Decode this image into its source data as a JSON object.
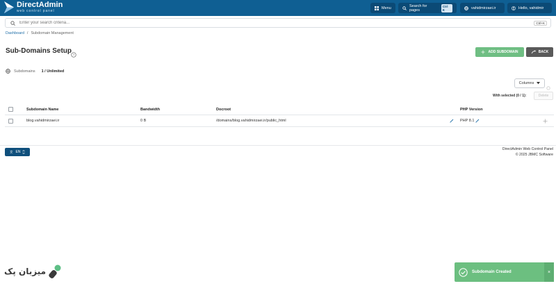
{
  "header": {
    "logo_title": "DirectAdmin",
    "logo_subtitle": "web control panel",
    "menu_label": "Menu",
    "search_pages_label": "Search for pages",
    "search_pages_kbd": "Ctrl K",
    "account_label": "vahidmirzaei.ir",
    "user_label": "Hello, vahidmir"
  },
  "search": {
    "placeholder": "Enter your search criteria...",
    "shortcut": "Ctrl+K"
  },
  "breadcrumb": {
    "home": "Dashboard",
    "separator": "/",
    "current": "Subdomain Management"
  },
  "page": {
    "title": "Sub-Domains Setup",
    "add_button": "ADD SUBDOMAIN",
    "back_button": "BACK",
    "summary_label": "Subdomains",
    "summary_count": "1 / Unlimited",
    "columns_button": "Columns",
    "with_selected": "With selected (0 / 1):",
    "delete_button": "Delete"
  },
  "table": {
    "headers": {
      "name": "Subdomain Name",
      "bandwidth": "Bandwidth",
      "docroot": "Docroot",
      "php": "PHP Version"
    },
    "rows": [
      {
        "name": "blog.vahidmirzaei.ir",
        "bandwidth": "0 B",
        "docroot": "/domains/blog.vahidmirzaei.ir/public_html",
        "php": "PHP 8.1"
      }
    ]
  },
  "footer": {
    "language": "EN",
    "line1": "DirectAdmin Web Control Panel",
    "line2": "© 2025 JBMC Software"
  },
  "watermark": {
    "text": "میزبان پک"
  },
  "toast": {
    "message": "Subdomain Created",
    "close": "×"
  },
  "colors": {
    "header_bg": "#0f5f93",
    "add_button": "#6fbe83",
    "back_button": "#5a5a5a",
    "toast": "#6cbf80"
  }
}
